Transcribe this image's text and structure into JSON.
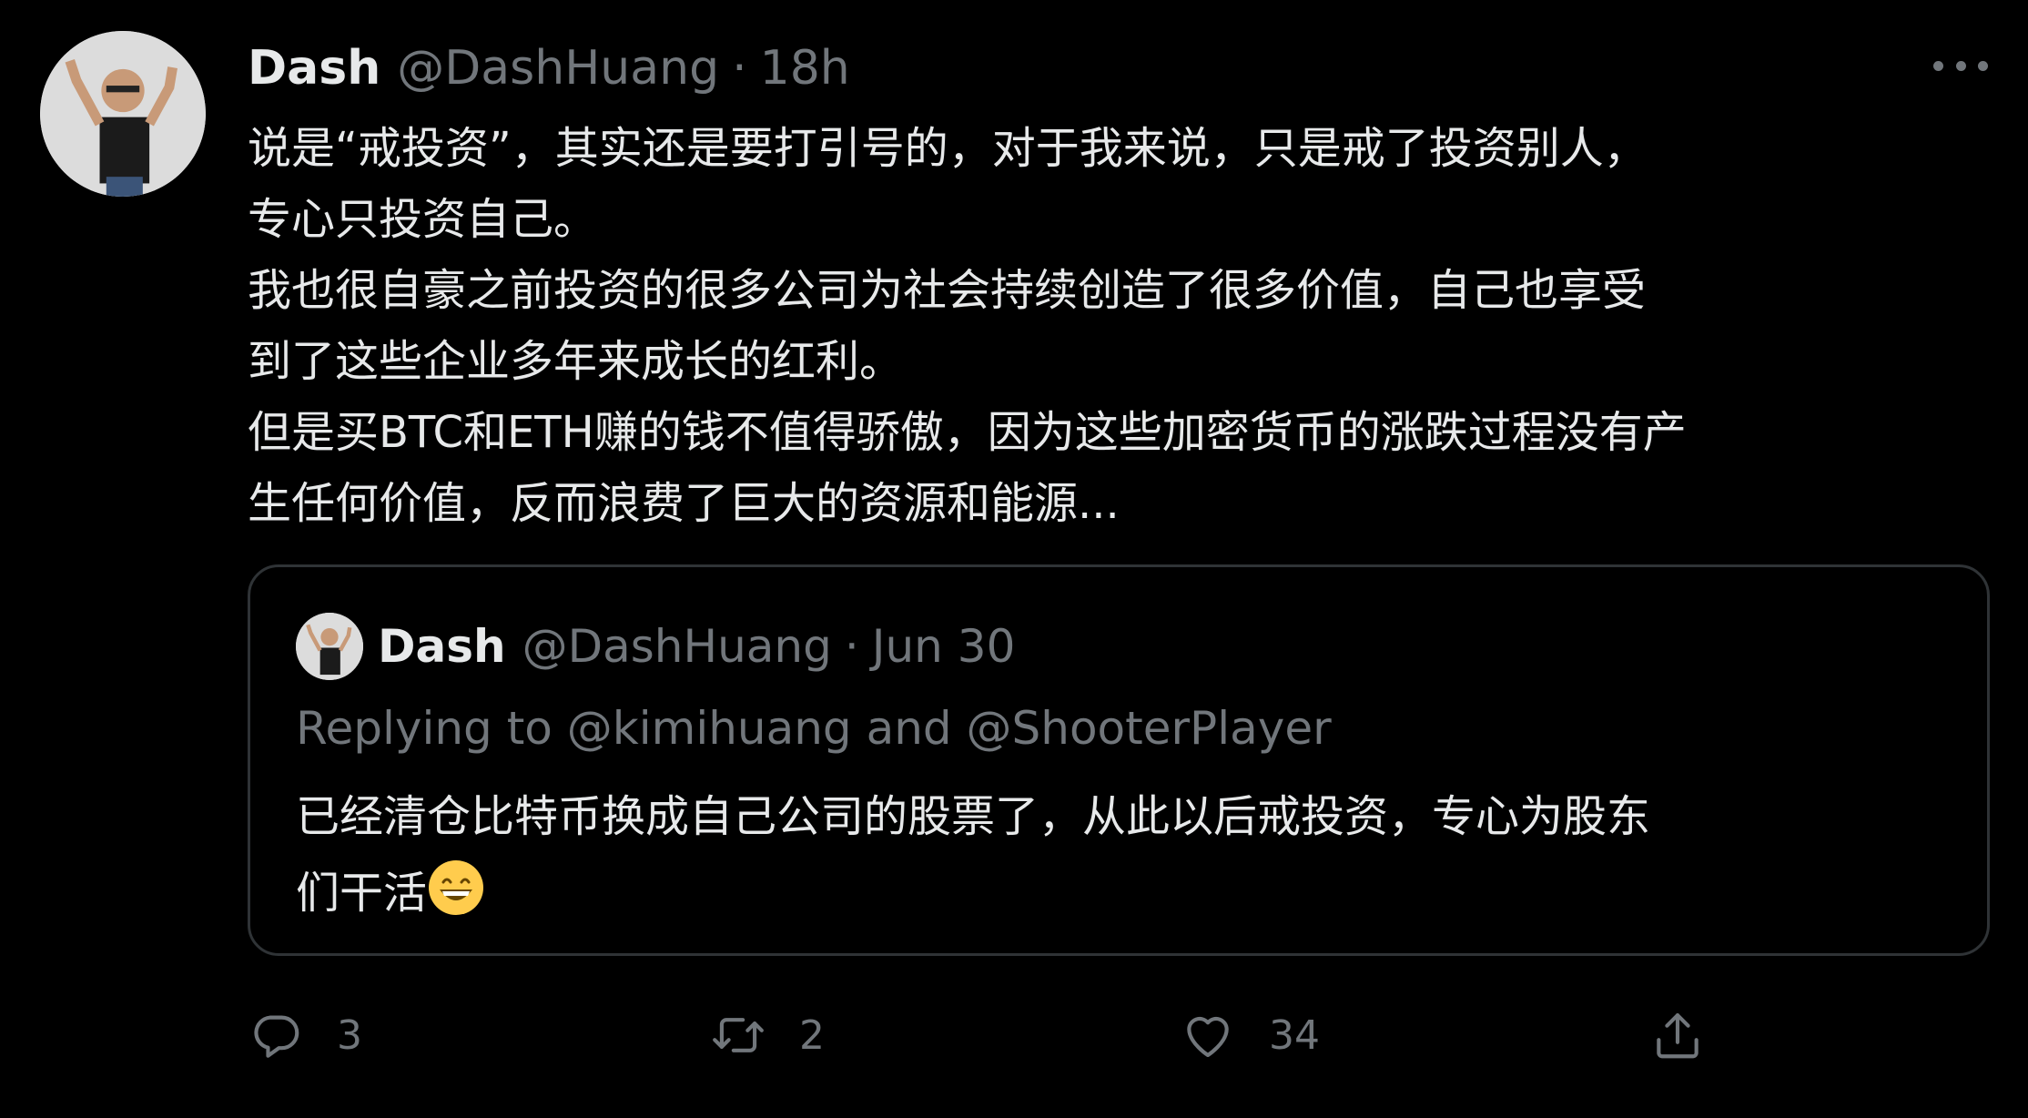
{
  "tweet": {
    "author_name": "Dash",
    "author_handle": "@DashHuang",
    "separator": "·",
    "time": "18h",
    "more_icon": "more-icon",
    "body_lines": [
      "说是“戒投资”，其实还是要打引号的，对于我来说，只是戒了投资别人，",
      "专心只投资自己。",
      "我也很自豪之前投资的很多公司为社会持续创造了很多价值，自己也享受",
      "到了这些企业多年来成长的红利。",
      "但是买BTC和ETH赚的钱不值得骄傲，因为这些加密货币的涨跌过程没有产",
      "生任何价值，反而浪费了巨大的资源和能源..."
    ]
  },
  "quoted_tweet": {
    "author_name": "Dash",
    "author_handle": "@DashHuang",
    "separator": "·",
    "time": "Jun 30",
    "replying_to": "Replying to @kimihuang and @ShooterPlayer",
    "text_lines": [
      "已经清仓比特币换成自己公司的股票了，从此以后戒投资，专心为股东",
      "们干活"
    ],
    "emoji": "grinning-face-with-smiling-eyes"
  },
  "actions": {
    "reply": {
      "icon": "reply-icon",
      "count": "3"
    },
    "retweet": {
      "icon": "retweet-icon",
      "count": "2"
    },
    "like": {
      "icon": "heart-icon",
      "count": "34"
    },
    "share": {
      "icon": "share-icon"
    }
  },
  "colors": {
    "background": "#000000",
    "text": "#e7e9ea",
    "secondary": "#71767b",
    "border": "#2f3336"
  }
}
